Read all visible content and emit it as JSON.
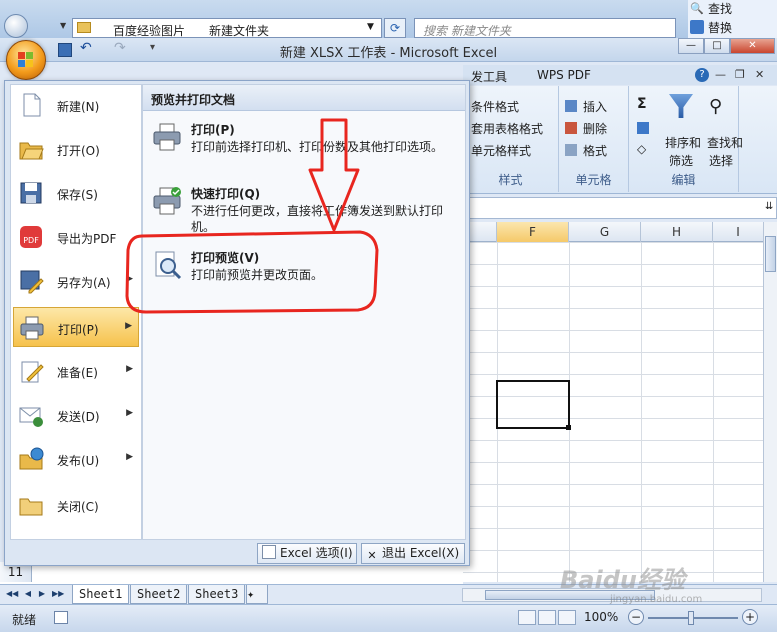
{
  "explorer": {
    "address_parts": [
      "百度经验图片",
      "新建文件夹"
    ],
    "search_placeholder": "搜索 新建文件夹",
    "find_label": "查找",
    "replace_label": "替换"
  },
  "window": {
    "title": "新建 XLSX 工作表 - Microsoft Excel"
  },
  "ribbon": {
    "tabs": [
      "发工具",
      "WPS PDF"
    ],
    "styles_group": {
      "items": [
        "条件格式",
        "套用表格格式",
        "单元格样式"
      ],
      "caption": "样式"
    },
    "cells_group": {
      "items": [
        "插入",
        "删除",
        "格式"
      ],
      "caption": "单元格"
    },
    "edit_group": {
      "sort_label_1": "排序和",
      "sort_label_2": "筛选",
      "find_label_1": "查找和",
      "find_label_2": "选择",
      "caption": "编辑"
    }
  },
  "grid": {
    "columns": [
      "F",
      "G",
      "H",
      "I"
    ],
    "row_label": "11"
  },
  "office_menu": {
    "left_items": [
      {
        "label": "新建(N)",
        "icon": "new-doc-icon",
        "has_arrow": false
      },
      {
        "label": "打开(O)",
        "icon": "open-folder-icon",
        "has_arrow": false
      },
      {
        "label": "保存(S)",
        "icon": "save-disk-icon",
        "has_arrow": false
      },
      {
        "label": "导出为PDF",
        "icon": "pdf-icon",
        "has_arrow": false
      },
      {
        "label": "另存为(A)",
        "icon": "save-as-icon",
        "has_arrow": true
      },
      {
        "label": "打印(P)",
        "icon": "printer-icon",
        "has_arrow": true
      },
      {
        "label": "准备(E)",
        "icon": "prepare-icon",
        "has_arrow": true
      },
      {
        "label": "发送(D)",
        "icon": "send-icon",
        "has_arrow": true
      },
      {
        "label": "发布(U)",
        "icon": "publish-icon",
        "has_arrow": true
      },
      {
        "label": "关闭(C)",
        "icon": "close-folder-icon",
        "has_arrow": false
      }
    ],
    "right_title": "预览并打印文档",
    "options": [
      {
        "title": "打印(P)",
        "desc": "打印前选择打印机、打印份数及其他打印选项。"
      },
      {
        "title": "快速打印(Q)",
        "desc": "不进行任何更改，直接将工作簿发送到默认打印机。"
      },
      {
        "title": "打印预览(V)",
        "desc": "打印前预览并更改页面。"
      }
    ],
    "footer": {
      "options_label": "Excel 选项(I)",
      "exit_label": "退出 Excel(X)"
    }
  },
  "sheets": [
    "Sheet1",
    "Sheet2",
    "Sheet3"
  ],
  "status": {
    "ready": "就绪",
    "zoom": "100%"
  },
  "watermark": {
    "main": "Baidu经验",
    "sub": "jingyan.baidu.com"
  },
  "colors": {
    "annotation_red": "#e8261f",
    "menu_highlight": "#f6c24c",
    "office_orange": "#f39b1b"
  }
}
